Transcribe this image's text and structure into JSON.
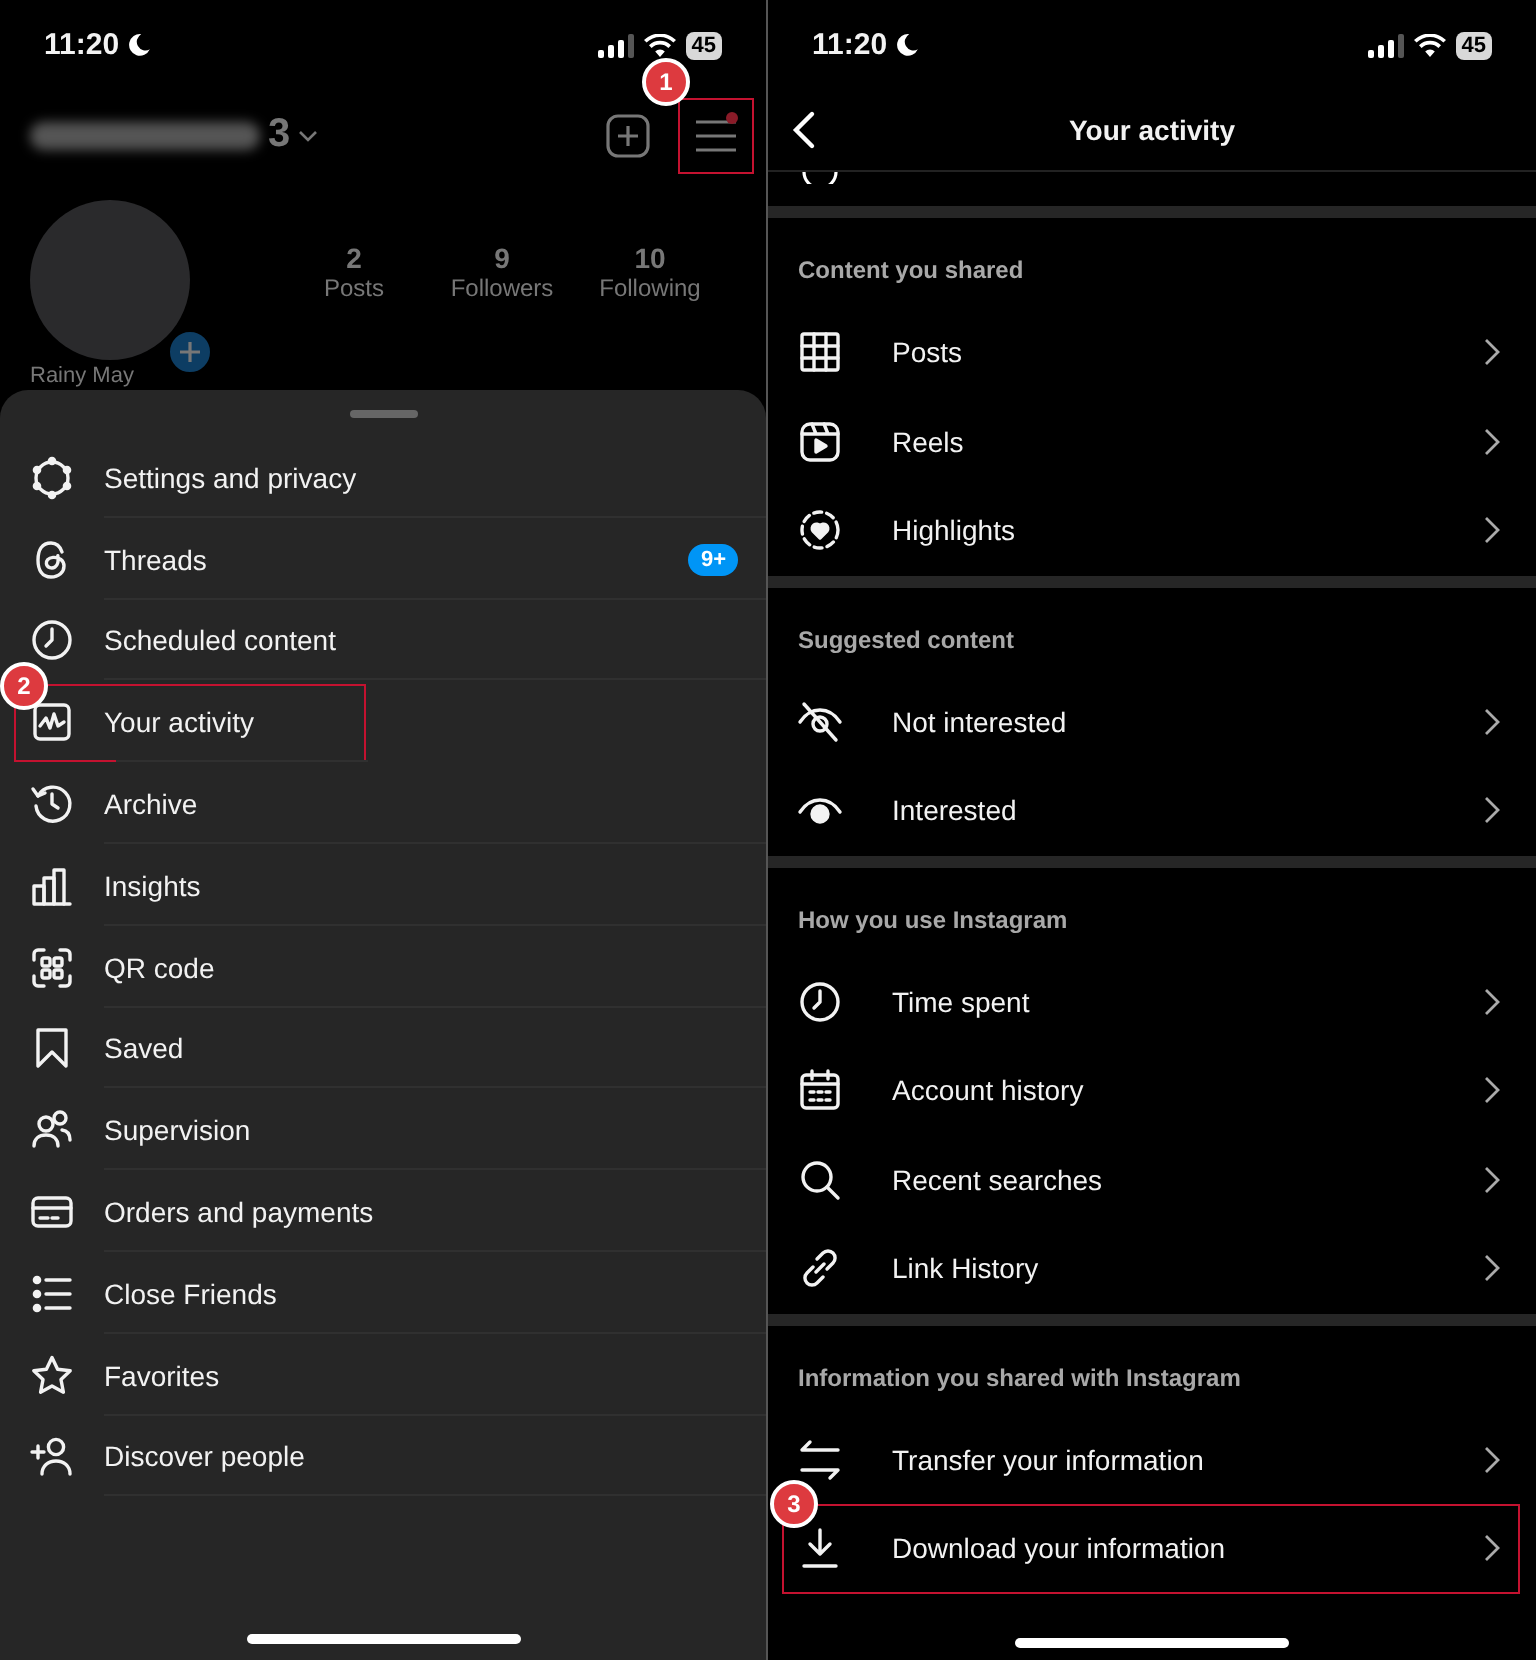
{
  "left_screen": {
    "status_bar": {
      "time": "11:20",
      "battery": "45"
    },
    "profile": {
      "username_visible": "3",
      "menu_callout": "1",
      "stats": [
        {
          "value": "2",
          "label": "Posts"
        },
        {
          "value": "9",
          "label": "Followers"
        },
        {
          "value": "10",
          "label": "Following"
        }
      ],
      "display_name": "Rainy May"
    },
    "menu": {
      "items": [
        {
          "label": "Settings and privacy"
        },
        {
          "label": "Threads",
          "badge": "9+"
        },
        {
          "label": "Scheduled content"
        },
        {
          "label": "Your activity",
          "callout": "2"
        },
        {
          "label": "Archive"
        },
        {
          "label": "Insights"
        },
        {
          "label": "QR code"
        },
        {
          "label": "Saved"
        },
        {
          "label": "Supervision"
        },
        {
          "label": "Orders and payments"
        },
        {
          "label": "Close Friends"
        },
        {
          "label": "Favorites"
        },
        {
          "label": "Discover people"
        }
      ]
    }
  },
  "right_screen": {
    "status_bar": {
      "time": "11:20",
      "battery": "45"
    },
    "title": "Your activity",
    "sections": [
      {
        "heading": "Content you shared",
        "items": [
          {
            "label": "Posts"
          },
          {
            "label": "Reels"
          },
          {
            "label": "Highlights"
          }
        ]
      },
      {
        "heading": "Suggested content",
        "items": [
          {
            "label": "Not interested"
          },
          {
            "label": "Interested"
          }
        ]
      },
      {
        "heading": "How you use Instagram",
        "items": [
          {
            "label": "Time spent"
          },
          {
            "label": "Account history"
          },
          {
            "label": "Recent searches"
          },
          {
            "label": "Link History"
          }
        ]
      },
      {
        "heading": "Information you shared with Instagram",
        "items": [
          {
            "label": "Transfer your information"
          },
          {
            "label": "Download your information",
            "callout": "3"
          }
        ]
      }
    ]
  }
}
